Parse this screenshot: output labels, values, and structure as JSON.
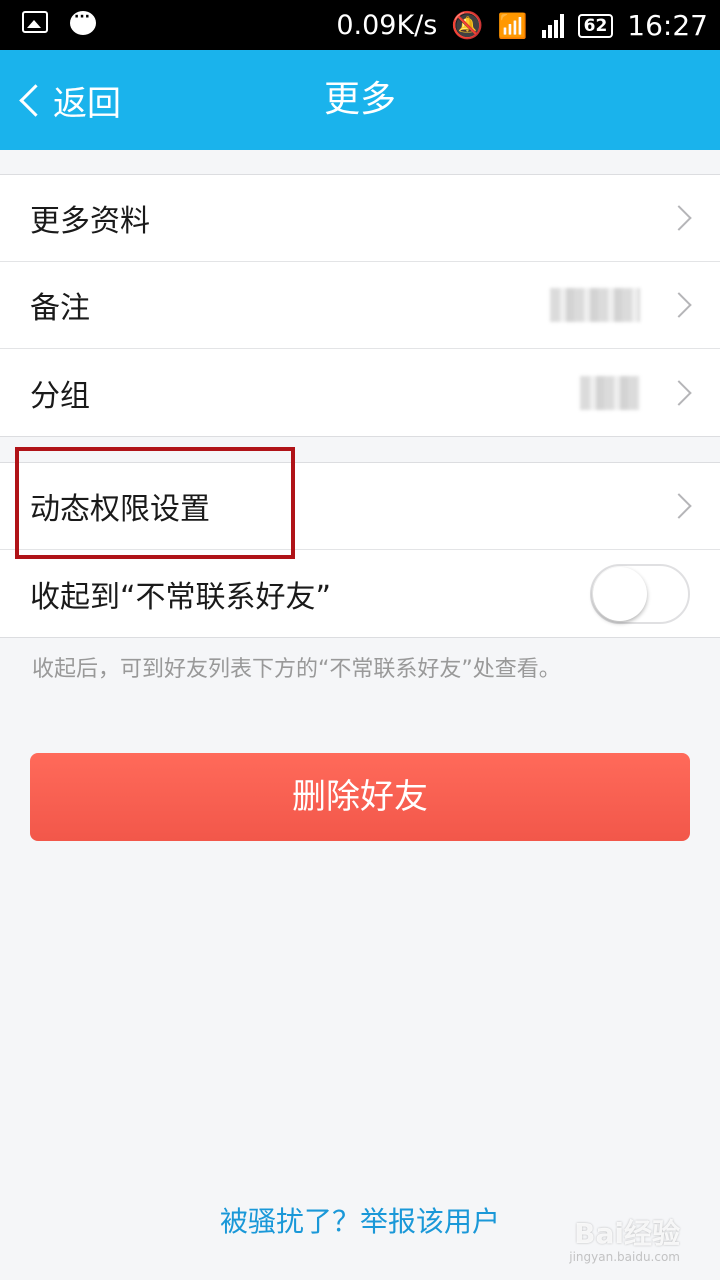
{
  "status_bar": {
    "speed": "0.09K/s",
    "battery": "62",
    "time": "16:27"
  },
  "header": {
    "back_label": "返回",
    "title": "更多"
  },
  "group1": [
    {
      "label": "更多资料"
    },
    {
      "label": "备注"
    },
    {
      "label": "分组"
    }
  ],
  "group2": [
    {
      "label": "动态权限设置"
    },
    {
      "label": "收起到“不常联系好友”",
      "toggle_on": false
    }
  ],
  "hint": "收起后，可到好友列表下方的“不常联系好友”处查看。",
  "delete_button": "删除好友",
  "report_link": "被骚扰了？举报该用户",
  "watermark": {
    "brand": "Bai经验",
    "url": "jingyan.baidu.com"
  },
  "colors": {
    "header": "#1ab3ec",
    "delete": "#f55e50",
    "link": "#1a98d8",
    "highlight": "#b01318"
  }
}
